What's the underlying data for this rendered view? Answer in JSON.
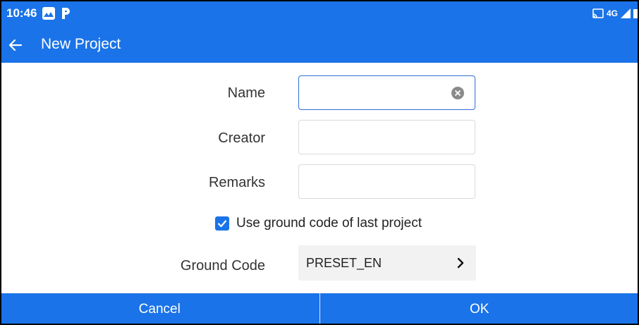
{
  "status_bar": {
    "time": "10:46",
    "network": "4G",
    "icons": [
      "photos-notification-icon",
      "p-app-notification-icon",
      "cast-icon",
      "signal-icon",
      "battery-icon"
    ]
  },
  "app_bar": {
    "back_icon": "arrow-left-icon",
    "title": "New Project"
  },
  "form": {
    "name": {
      "label": "Name",
      "value": "",
      "placeholder": ""
    },
    "creator": {
      "label": "Creator",
      "value": "",
      "placeholder": ""
    },
    "remarks": {
      "label": "Remarks",
      "value": "",
      "placeholder": ""
    },
    "use_last_ground_code": {
      "label": "Use ground code of last project",
      "checked": true
    },
    "ground_code": {
      "label": "Ground Code",
      "value": "PRESET_EN"
    }
  },
  "actions": {
    "cancel_label": "Cancel",
    "ok_label": "OK"
  },
  "colors": {
    "primary": "#1a73e8",
    "background": "#ffffff",
    "input_border": "#dadada",
    "focus_border": "#2f6fd1",
    "select_bg": "#f2f2f2"
  }
}
